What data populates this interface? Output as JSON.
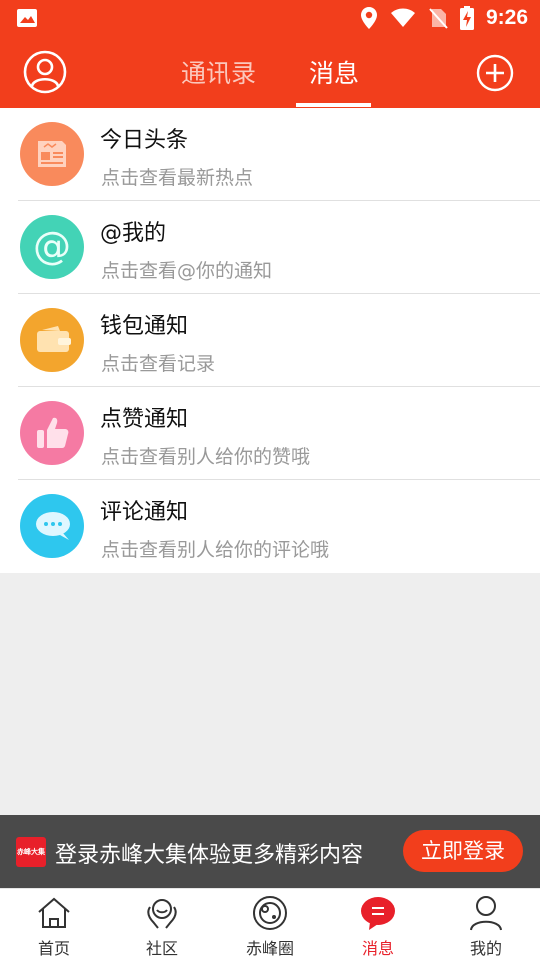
{
  "status_bar": {
    "time": "9:26"
  },
  "header": {
    "tabs": [
      {
        "label": "通讯录",
        "active": false
      },
      {
        "label": "消息",
        "active": true
      }
    ]
  },
  "messages": [
    {
      "title": "今日头条",
      "subtitle": "点击查看最新热点",
      "icon": "newspaper-icon",
      "color": "#f98a5c"
    },
    {
      "title": "@我的",
      "subtitle": "点击查看@你的通知",
      "icon": "at-sign-icon",
      "color": "#43d3b6"
    },
    {
      "title": "钱包通知",
      "subtitle": "点击查看记录",
      "icon": "wallet-icon",
      "color": "#f3a52d"
    },
    {
      "title": "点赞通知",
      "subtitle": "点击查看别人给你的赞哦",
      "icon": "thumbs-up-icon",
      "color": "#f57aa3"
    },
    {
      "title": "评论通知",
      "subtitle": "点击查看别人给你的评论哦",
      "icon": "comment-icon",
      "color": "#2ec7ee"
    }
  ],
  "login_banner": {
    "logo_text": "赤峰大集",
    "text": "登录赤峰大集体验更多精彩内容",
    "button": "立即登录"
  },
  "bottom_nav": [
    {
      "label": "首页",
      "icon": "home-icon",
      "active": false
    },
    {
      "label": "社区",
      "icon": "community-icon",
      "active": false
    },
    {
      "label": "赤峰圈",
      "icon": "circle-icon",
      "active": false
    },
    {
      "label": "消息",
      "icon": "message-icon",
      "active": true
    },
    {
      "label": "我的",
      "icon": "profile-icon",
      "active": false
    }
  ],
  "colors": {
    "brand": "#f23e1c",
    "active_nav": "#e8202a"
  }
}
